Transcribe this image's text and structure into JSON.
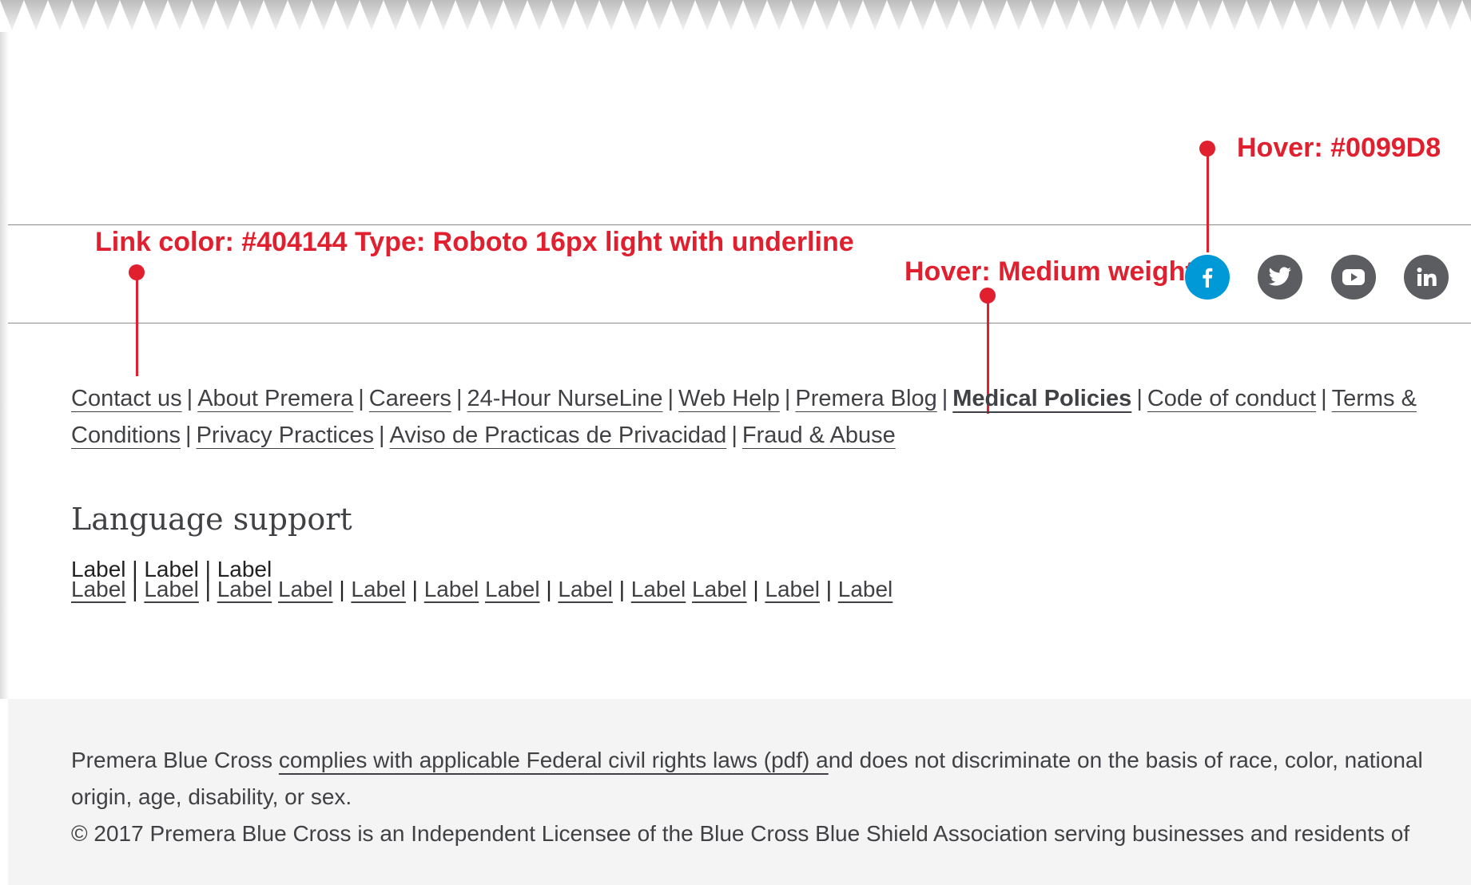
{
  "annotations": {
    "hover_color": "Hover: #0099D8",
    "link_spec": "Link color: #404144  Type: Roboto 16px light with underline",
    "hover_weight": "Hover: Medium weight"
  },
  "social": [
    {
      "name": "facebook",
      "icon": "facebook-icon",
      "color": "#0099D8"
    },
    {
      "name": "twitter",
      "icon": "twitter-icon",
      "color": "#5C5D61"
    },
    {
      "name": "youtube",
      "icon": "youtube-icon",
      "color": "#5C5D61"
    },
    {
      "name": "linkedin",
      "icon": "linkedin-icon",
      "color": "#5C5D61"
    }
  ],
  "footer_links": [
    "Contact us",
    "About Premera",
    "Careers",
    "24-Hour NurseLine",
    "Web Help",
    "Premera Blog",
    "Medical Policies",
    "Code of conduct",
    "Terms &",
    "Conditions",
    "Privacy Practices",
    "Aviso de Practicas de Privacidad",
    "Fraud & Abuse"
  ],
  "separator": "|",
  "language": {
    "title": "Language support",
    "label": "Label"
  },
  "legal": {
    "line1_pre": "Premera Blue Cross ",
    "line1_link": "complies with applicable Federal civil rights laws (pdf) a",
    "line1_post": "nd does not discriminate on the basis of race, color, national",
    "line2": "origin, age, disability, or sex.",
    "line3": "© 2017 Premera Blue Cross is an Independent Licensee of the Blue Cross Blue Shield Association serving businesses and residents of"
  },
  "colors": {
    "annotation": "#E0202F",
    "link": "#404144",
    "hover": "#0099D8"
  }
}
